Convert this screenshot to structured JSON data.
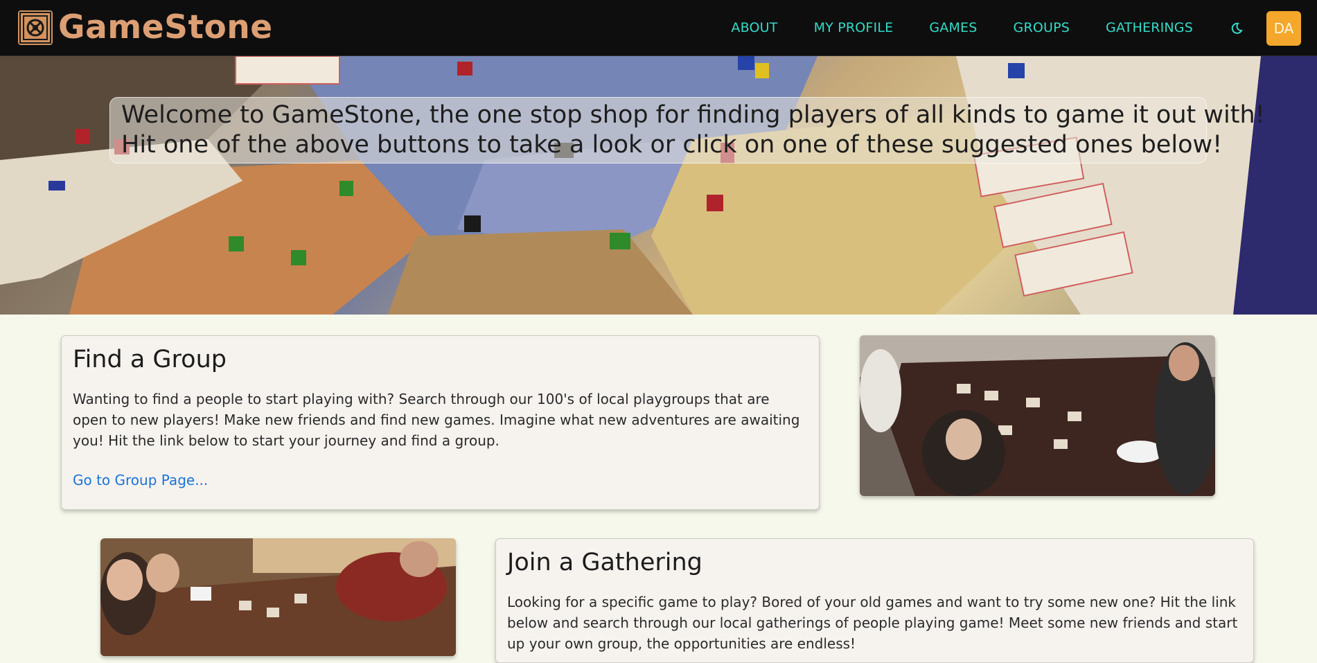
{
  "navbar": {
    "brand": "GameStone",
    "links": [
      "ABOUT",
      "MY PROFILE",
      "GAMES",
      "GROUPS",
      "GATHERINGS"
    ],
    "theme_icon": "moon-icon",
    "avatar_initials": "DA"
  },
  "hero": {
    "line1": "Welcome to GameStone, the one stop shop for finding players of all kinds to game it out with!",
    "line2": "Hit one of the above buttons to take a look or click on one of these suggested ones below!"
  },
  "group_card": {
    "title": "Find a Group",
    "body": "Wanting to find a people to start playing with? Search through our 100's of local playgroups that are open to new players! Make new friends and find new games. Imagine what new adventures are awaiting you! Hit the link below to start your journey and find a group.",
    "link": "Go to Group Page..."
  },
  "gathering_card": {
    "title": "Join a Gathering",
    "body": "Looking for a specific game to play? Bored of your old games and want to try some new one? Hit the link below and search through our local gatherings of people playing game! Meet some new friends and start up your own group, the opportunities are endless!"
  },
  "colors": {
    "nav_bg": "#0e0e0e",
    "brand": "#dc9f74",
    "nav_link": "#33dcc8",
    "avatar_bg": "#f4a72a",
    "page_bg": "#f6f8ec",
    "link": "#1a73d8"
  }
}
